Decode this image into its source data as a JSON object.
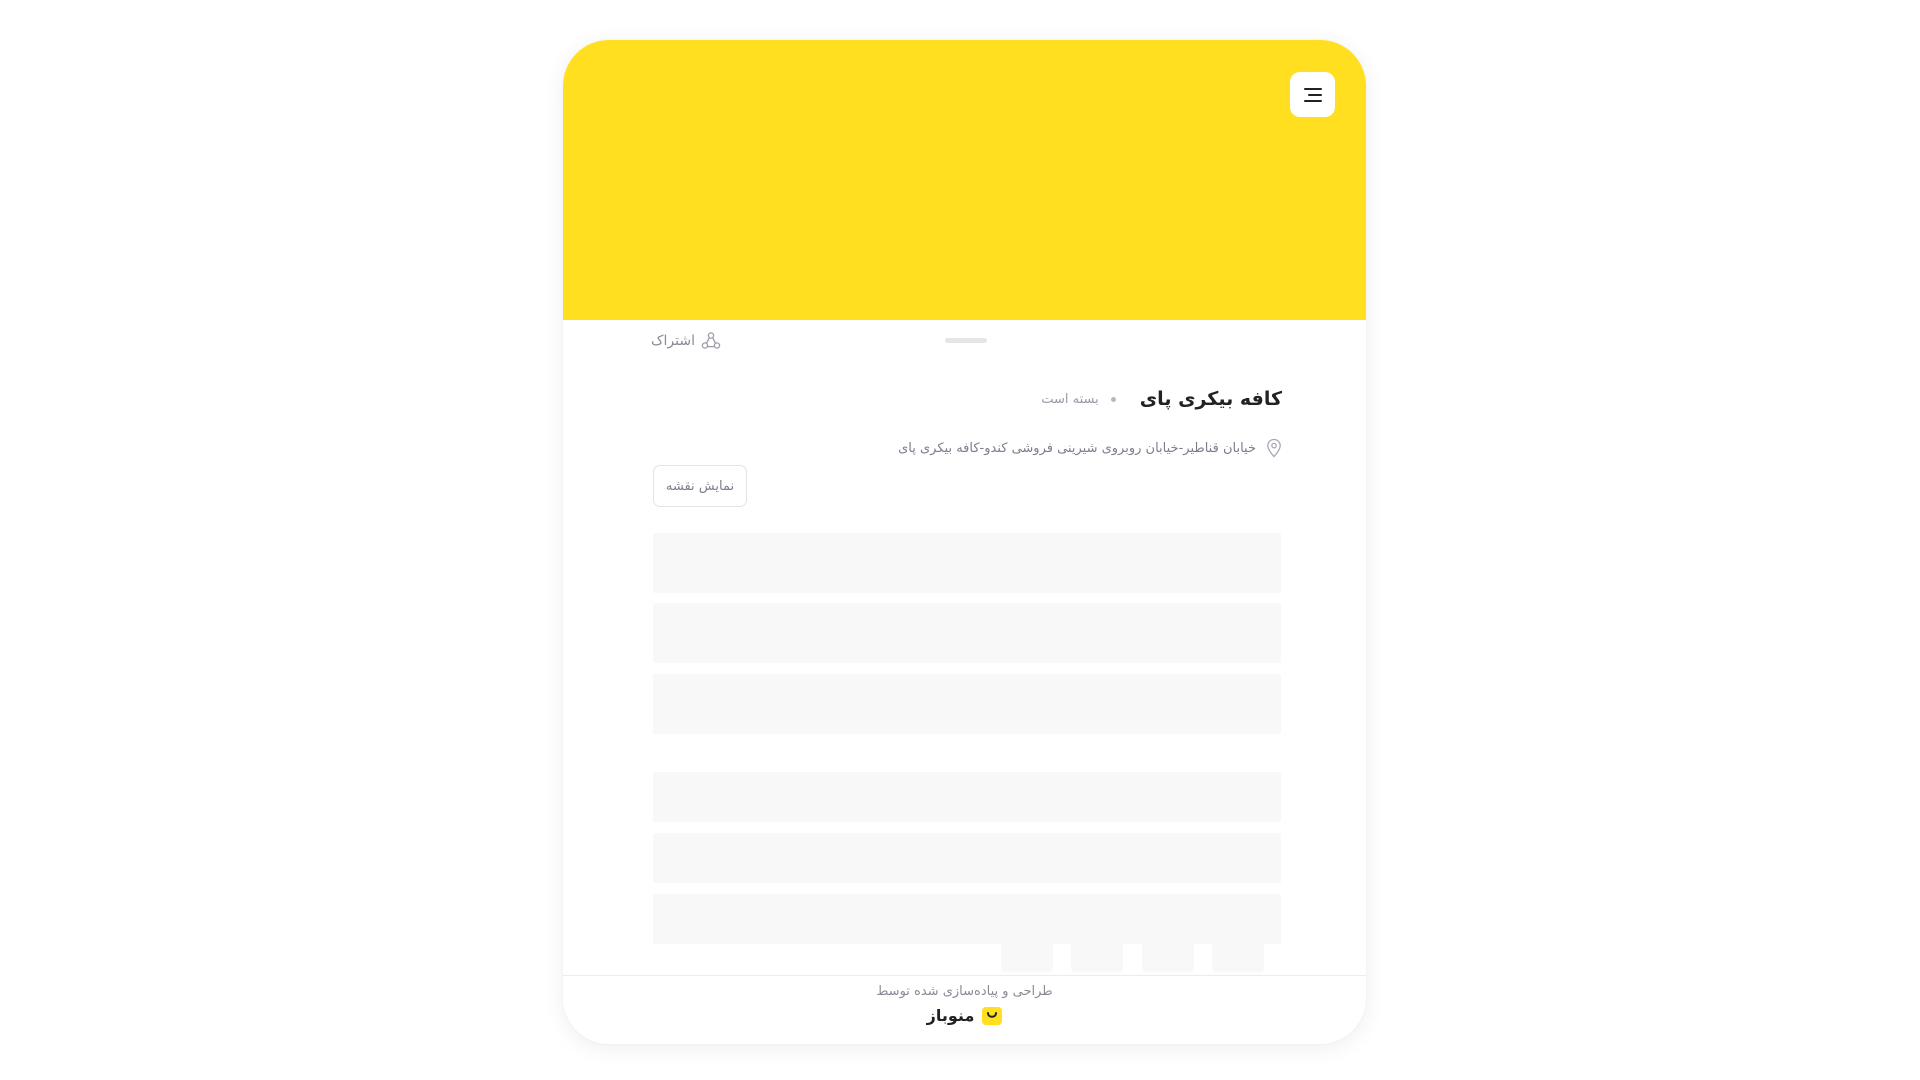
{
  "header": {
    "banner_color": "#FFDF20",
    "menu_icon": "menu-icon"
  },
  "sheet": {
    "share_label": "اشتراک",
    "share_icon": "share-icon",
    "title": "کافه بیکری پای",
    "status": "بسته است",
    "address": "خیابان قناطیر-خیابان روبروی شیرینی فروشی کندو-کافه بیکری پای",
    "location_icon": "location-pin-icon",
    "map_button_label": "نمایش نقشه"
  },
  "footer": {
    "credit": "طراحی و پیاده‌سازی شده توسط",
    "brand_name": "منوباز",
    "brand_logo_icon": "brand-logo-icon"
  }
}
